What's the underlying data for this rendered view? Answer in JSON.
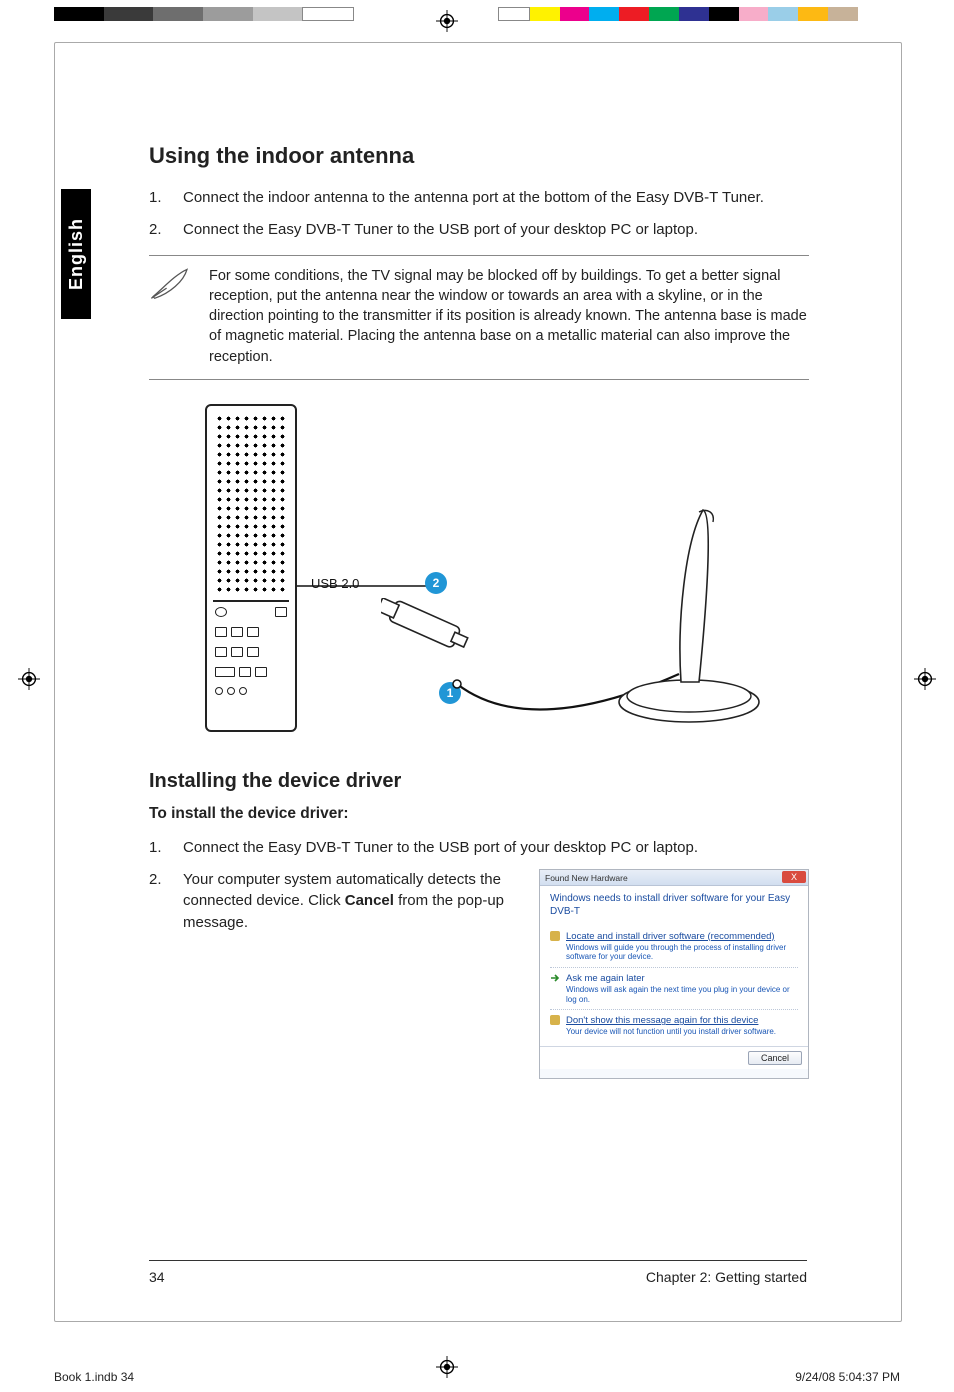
{
  "colorbars": {
    "left": [
      "#000000",
      "#3a3a3a",
      "#6e6e6e",
      "#9c9c9c",
      "#c4c4c4",
      "#ffffff"
    ],
    "right": [
      "#ffffff",
      "#fff200",
      "#ec008c",
      "#00aeef",
      "#ed1c24",
      "#00a651",
      "#2e3192",
      "#000000",
      "#f7adc9",
      "#9acee8",
      "#fdb913",
      "#c7b299"
    ]
  },
  "side_tab": "English",
  "section1": {
    "heading": "Using the indoor antenna",
    "items": [
      {
        "num": "1.",
        "text": "Connect the indoor antenna to the antenna port at the bottom of the Easy DVB-T Tuner."
      },
      {
        "num": "2.",
        "text": "Connect the Easy DVB-T Tuner to the USB port of your desktop PC or laptop."
      }
    ],
    "note": "For some conditions, the TV signal may be blocked off by buildings. To get a better signal reception, put the antenna near the window or towards an area with a skyline, or in the direction pointing to the transmitter if its position is already known.  The antenna base is made of magnetic material. Placing the antenna base on a metallic material can also improve the reception."
  },
  "diagram": {
    "usb_label": "USB 2.0",
    "badge1": "1",
    "badge2": "2"
  },
  "section2": {
    "heading": "Installing the device driver",
    "subheading": "To install the device driver:",
    "items": [
      {
        "num": "1.",
        "text": "Connect the Easy DVB-T Tuner to the USB port of your desktop PC or laptop."
      },
      {
        "num": "2.",
        "pre": "Your computer system automatically detects the connected device. Click ",
        "bold": "Cancel",
        "post": " from the pop-up message."
      }
    ]
  },
  "dialog": {
    "title": "Found New Hardware",
    "close": "X",
    "message": "Windows needs to install driver software for your Easy DVB-T",
    "options": [
      {
        "type": "shield",
        "title": "Locate and install driver software (recommended)",
        "sub": "Windows will guide you through the process of installing driver software for your device."
      },
      {
        "type": "arrow",
        "title": "Ask me again later",
        "sub": "Windows will ask again the next time you plug in your device or log on."
      },
      {
        "type": "shield",
        "title": "Don't show this message again for this device",
        "sub": "Your device will not function until you install driver software."
      }
    ],
    "button": "Cancel"
  },
  "footer": {
    "page_num": "34",
    "chapter": "Chapter 2: Getting started"
  },
  "printfoot": {
    "left": "Book 1.indb   34",
    "right": "9/24/08   5:04:37 PM"
  }
}
